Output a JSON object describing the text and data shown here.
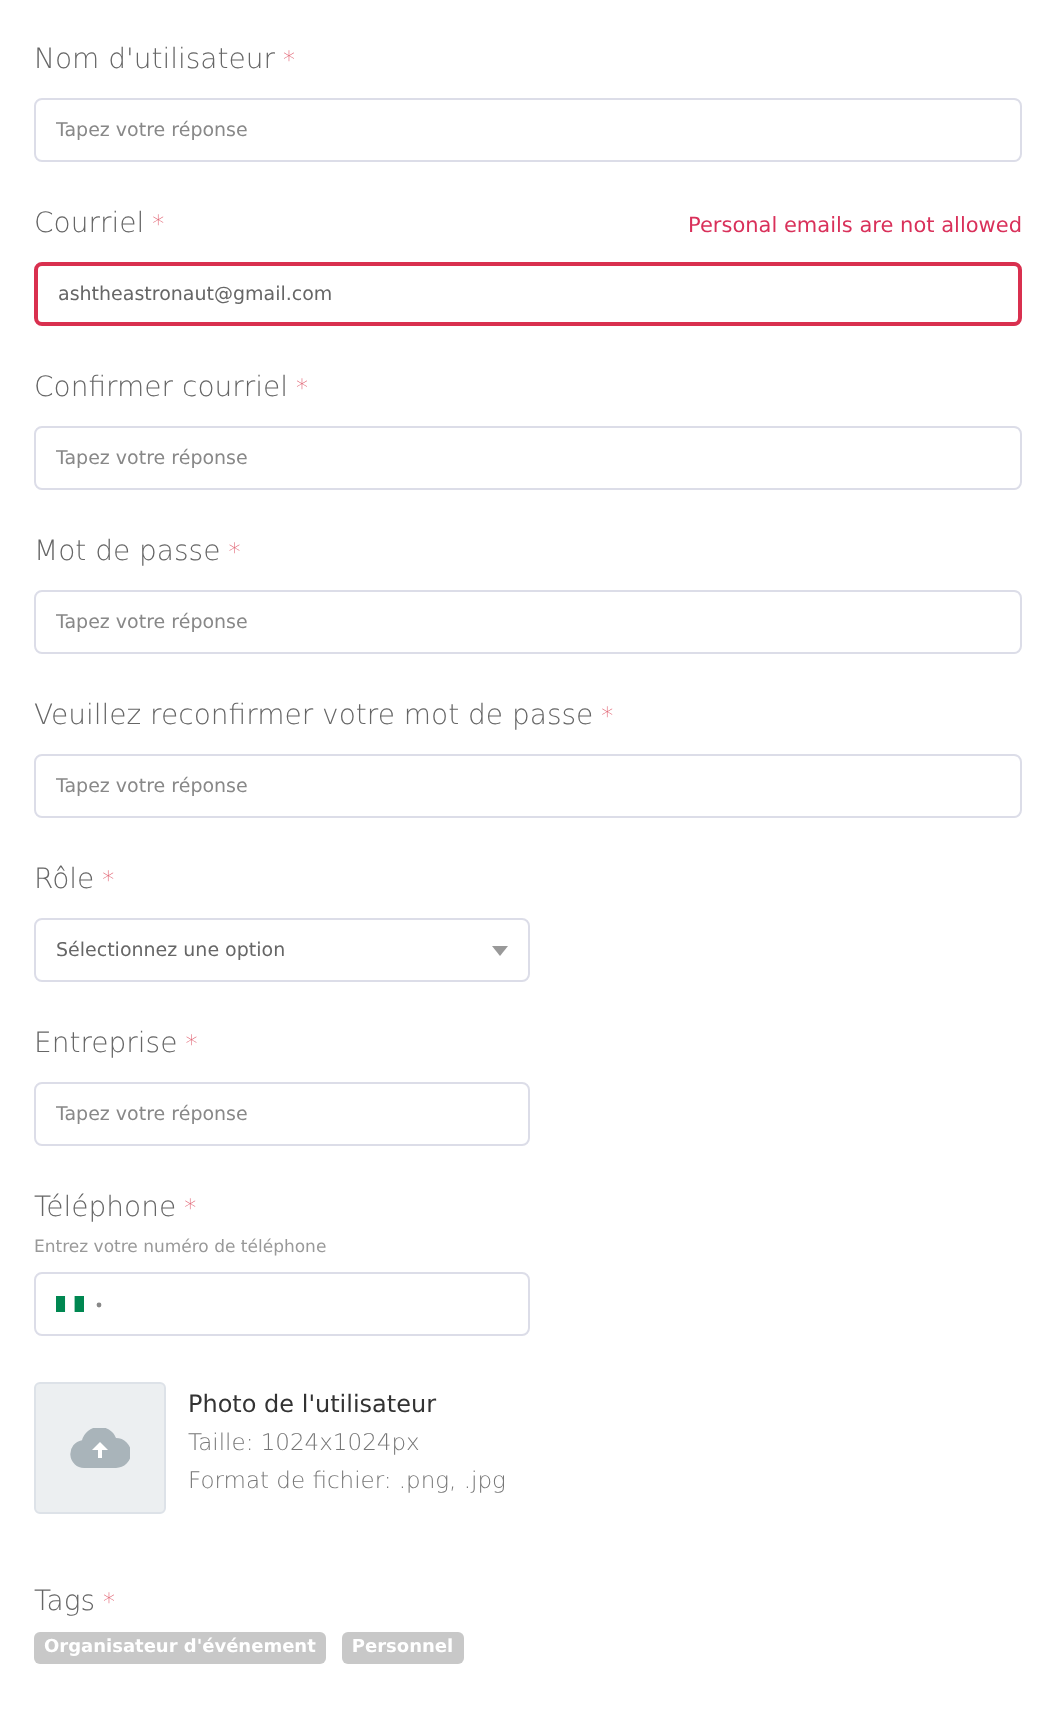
{
  "fields": [
    {
      "kind": "text",
      "label": "Nom d'utilisateur",
      "mark": "*",
      "placeholder": "Tapez votre réponse",
      "wide": true
    },
    {
      "kind": "text",
      "label": "Courriel",
      "mark": "*",
      "value": "ashtheastronaut@gmail.com",
      "error": "Personal emails are not allowed",
      "wide": true
    },
    {
      "kind": "text",
      "label": "Confirmer courriel",
      "mark": "*",
      "placeholder": "Tapez votre réponse",
      "wide": true
    },
    {
      "kind": "text",
      "label": "Mot de passe",
      "mark": "*",
      "placeholder": "Tapez votre réponse",
      "wide": true
    },
    {
      "kind": "text",
      "label": "Veuillez reconfirmer votre mot de passe",
      "mark": "*",
      "placeholder": "Tapez votre réponse",
      "wide": true
    },
    {
      "kind": "select",
      "label": "Rôle",
      "mark": "*",
      "placeholder": "Sélectionnez une option",
      "wide": false
    },
    {
      "kind": "text",
      "label": "Entreprise",
      "mark": "*",
      "placeholder": "Tapez votre réponse",
      "wide": false
    },
    {
      "kind": "phone",
      "label": "Téléphone",
      "mark": "*",
      "hint": "Entrez votre numéro de téléphone",
      "wide": false
    }
  ],
  "photo": {
    "title": "Photo de l'utilisateur",
    "lines": [
      "Taille: 1024x1024px",
      "Format de fichier: .png, .jpg"
    ]
  },
  "tags": {
    "label": "Tags",
    "mark": "*",
    "items": [
      "Organisateur d'événement",
      "Personnel"
    ]
  }
}
